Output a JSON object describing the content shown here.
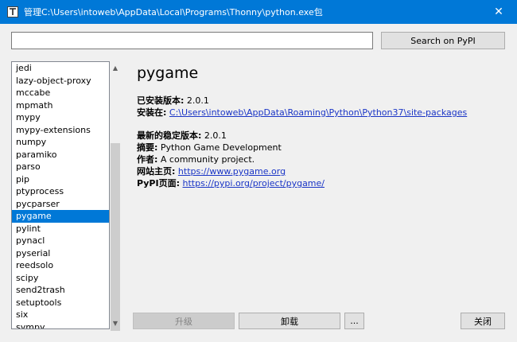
{
  "window": {
    "title": "管理C:\\Users\\intoweb\\AppData\\Local\\Programs\\Thonny\\python.exe包",
    "close_glyph": "✕"
  },
  "search": {
    "value": "",
    "button_label": "Search on PyPI"
  },
  "packages": {
    "items": [
      "jedi",
      "lazy-object-proxy",
      "mccabe",
      "mpmath",
      "mypy",
      "mypy-extensions",
      "numpy",
      "paramiko",
      "parso",
      "pip",
      "ptyprocess",
      "pycparser",
      "pygame",
      "pylint",
      "pynacl",
      "pyserial",
      "reedsolo",
      "scipy",
      "send2trash",
      "setuptools",
      "six",
      "sympy"
    ],
    "selected": "pygame"
  },
  "details": {
    "name": "pygame",
    "installed_label": "已安装版本:",
    "installed_version": "2.0.1",
    "location_label": "安装在:",
    "location": "C:\\Users\\intoweb\\AppData\\Roaming\\Python\\Python37\\site-packages",
    "latest_label": "最新的稳定版本:",
    "latest_version": "2.0.1",
    "summary_label": "摘要:",
    "summary": "Python Game Development",
    "author_label": "作者:",
    "author": "A community project.",
    "homepage_label": "网站主页:",
    "homepage": "https://www.pygame.org",
    "pypi_label": "PyPI页面:",
    "pypi": "https://pypi.org/project/pygame/"
  },
  "buttons": {
    "upgrade": "升级",
    "uninstall": "卸载",
    "more": "...",
    "close": "关闭"
  },
  "icons": {
    "app": "thonny-icon",
    "scroll_up": "▲",
    "scroll_down": "▼"
  },
  "colors": {
    "titlebar": "#0078d7",
    "selection": "#0078d7",
    "link": "#1a35c6"
  }
}
